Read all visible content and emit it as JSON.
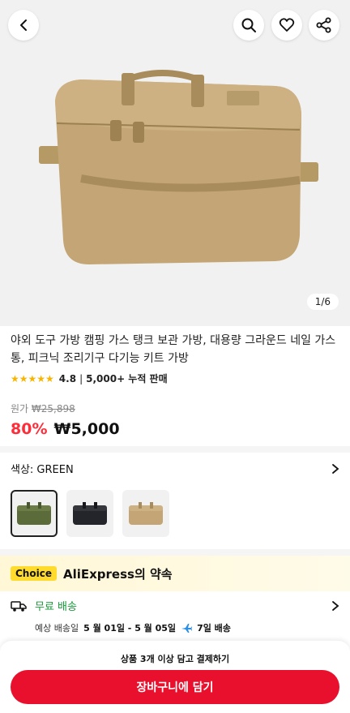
{
  "header": {
    "icons": [
      "back-arrow-icon",
      "search-icon",
      "heart-icon",
      "share-icon"
    ]
  },
  "gallery": {
    "page_indicator": "1/6"
  },
  "product": {
    "title": "야외 도구 가방 캠핑 가스 탱크 보관 가방, 대용량 그라운드 네일 가스통, 피크닉 조리기구 다기능 키트 가방",
    "stars": "★★★★★",
    "rating": "4.8",
    "separator": "|",
    "sold": "5,000+ 누적 판매",
    "original_price_label": "원가",
    "original_price": "₩25,898",
    "discount": "80%",
    "price": "₩5,000"
  },
  "color_selector": {
    "label": "색상: GREEN",
    "variants": [
      "green",
      "black",
      "khaki"
    ],
    "selected_index": 0
  },
  "choice": {
    "badge": "Choice",
    "title": "AliExpress의 약속"
  },
  "shipping": {
    "label": "무료 배송",
    "delivery_label": "예상 배송일",
    "delivery_dates": "5 월 01일 - 5 월 05일",
    "delivery_days": "7일 배송"
  },
  "bottom": {
    "promo": "상품 3개 이상 담고 결제하기",
    "cart_button": "장바구니에 담기"
  },
  "colors": {
    "accent_red": "#e8102d",
    "discount_red": "#ff2d3a",
    "star_yellow": "#f7b500",
    "choice_yellow": "#ffdb2e",
    "shipping_green": "#1a9a3a"
  }
}
